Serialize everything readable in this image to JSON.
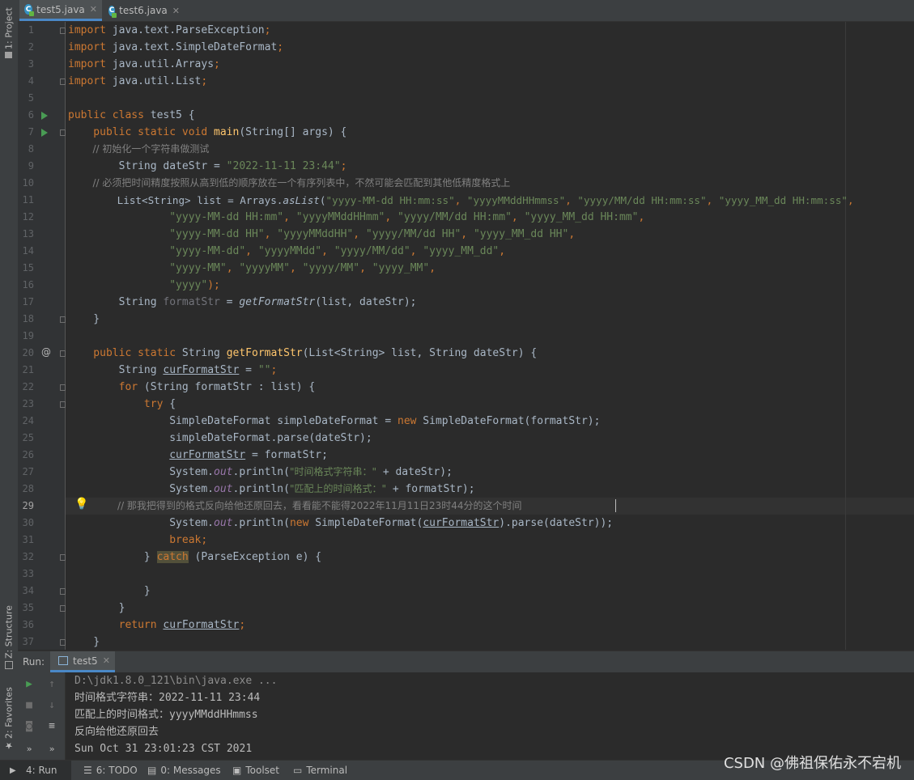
{
  "left_strip": {
    "project_label": "1: Project",
    "structure_label": "Z: Structure",
    "favorites_label": "2: Favorites"
  },
  "tabs": [
    {
      "label": "test5.java",
      "active": true
    },
    {
      "label": "test6.java",
      "active": false
    }
  ],
  "code_lines": [
    "1",
    "2",
    "3",
    "4",
    "5",
    "6",
    "7",
    "8",
    "9",
    "10",
    "11",
    "12",
    "13",
    "14",
    "15",
    "16",
    "17",
    "18",
    "19",
    "20",
    "21",
    "22",
    "23",
    "24",
    "25",
    "26",
    "27",
    "28",
    "29",
    "30",
    "31",
    "32",
    "33",
    "34",
    "35",
    "36",
    "37"
  ],
  "code": {
    "l1": [
      "import",
      " java.text.ParseException",
      ";"
    ],
    "l2": [
      "import",
      " java.text.SimpleDateFormat",
      ";"
    ],
    "l3": [
      "import",
      " java.util.Arrays",
      ";"
    ],
    "l4": [
      "import",
      " java.util.List",
      ";"
    ],
    "l6": [
      "public class",
      " test5 {"
    ],
    "l7": [
      "    public static void",
      " main",
      "(String[] args) {"
    ],
    "l8": "        // 初始化一个字符串做测试",
    "l9": [
      "        String dateStr = ",
      "\"2022-11-11 23:44\"",
      ";"
    ],
    "l10": "        // 必须把时间精度按照从高到低的顺序放在一个有序列表中，不然可能会匹配到其他低精度格式上",
    "l11": [
      "        List<String> list = Arrays.",
      "asList",
      "(",
      "\"yyyy-MM-dd HH:mm:ss\"",
      ", ",
      "\"yyyyMMddHHmmss\"",
      ", ",
      "\"yyyy/MM/dd HH:mm:ss\"",
      ", ",
      "\"yyyy_MM_dd HH:mm:ss\"",
      ","
    ],
    "l12": [
      "                ",
      "\"yyyy-MM-dd HH:mm\"",
      ", ",
      "\"yyyyMMddHHmm\"",
      ", ",
      "\"yyyy/MM/dd HH:mm\"",
      ", ",
      "\"yyyy_MM_dd HH:mm\"",
      ","
    ],
    "l13": [
      "                ",
      "\"yyyy-MM-dd HH\"",
      ", ",
      "\"yyyyMMddHH\"",
      ", ",
      "\"yyyy/MM/dd HH\"",
      ", ",
      "\"yyyy_MM_dd HH\"",
      ","
    ],
    "l14": [
      "                ",
      "\"yyyy-MM-dd\"",
      ", ",
      "\"yyyyMMdd\"",
      ", ",
      "\"yyyy/MM/dd\"",
      ", ",
      "\"yyyy_MM_dd\"",
      ","
    ],
    "l15": [
      "                ",
      "\"yyyy-MM\"",
      ", ",
      "\"yyyyMM\"",
      ", ",
      "\"yyyy/MM\"",
      ", ",
      "\"yyyy_MM\"",
      ","
    ],
    "l16": [
      "                ",
      "\"yyyy\"",
      ");"
    ],
    "l17": [
      "        String ",
      "formatStr",
      " = ",
      "getFormatStr",
      "(list, dateStr);"
    ],
    "l18": "    }",
    "l20": [
      "    public static",
      " String ",
      "getFormatStr",
      "(List<String> list, String dateStr) {"
    ],
    "l21": [
      "        String ",
      "curFormatStr",
      " = ",
      "\"\"",
      ";"
    ],
    "l22": [
      "        for",
      " (String formatStr : list) {"
    ],
    "l23": [
      "            try",
      " {"
    ],
    "l24": [
      "                SimpleDateFormat simpleDateFormat = ",
      "new",
      " SimpleDateFormat(formatStr);"
    ],
    "l25": "                simpleDateFormat.parse(dateStr);",
    "l26": [
      "                ",
      "curFormatStr",
      " = formatStr;"
    ],
    "l27": [
      "                System.",
      "out",
      ".println(",
      "\"时间格式字符串：\"",
      " + dateStr);"
    ],
    "l28": [
      "                System.",
      "out",
      ".println(",
      "\"匹配上的时间格式：\"",
      " + formatStr);"
    ],
    "l29": "                // 那我把得到的格式反向给他还原回去，看看能不能得2022年11月11日23时44分的这个时间",
    "l30": [
      "                System.",
      "out",
      ".println(",
      "new",
      " SimpleDateFormat(",
      "curFormatStr",
      ").parse(dateStr));"
    ],
    "l31": [
      "                ",
      "break",
      ";"
    ],
    "l32": [
      "            } ",
      "catch",
      " (ParseException e) {"
    ],
    "l34": "            }",
    "l35": "        }",
    "l36": [
      "        ",
      "return",
      " ",
      "curFormatStr",
      ";"
    ],
    "l37": "    }"
  },
  "run_panel": {
    "run_label": "Run:",
    "tab_label": "test5",
    "console": [
      "D:\\jdk1.8.0_121\\bin\\java.exe ...",
      "时间格式字符串：2022-11-11 23:44",
      "匹配上的时间格式：yyyyMMddHHmmss",
      "反向给他还原回去",
      "Sun Oct 31 23:01:23 CST 2021"
    ]
  },
  "status_bar": {
    "run": "4: Run",
    "todo": "6: TODO",
    "messages": "0: Messages",
    "toolset": "Toolset",
    "terminal": "Terminal"
  },
  "watermark": "CSDN @佛祖保佑永不宕机"
}
